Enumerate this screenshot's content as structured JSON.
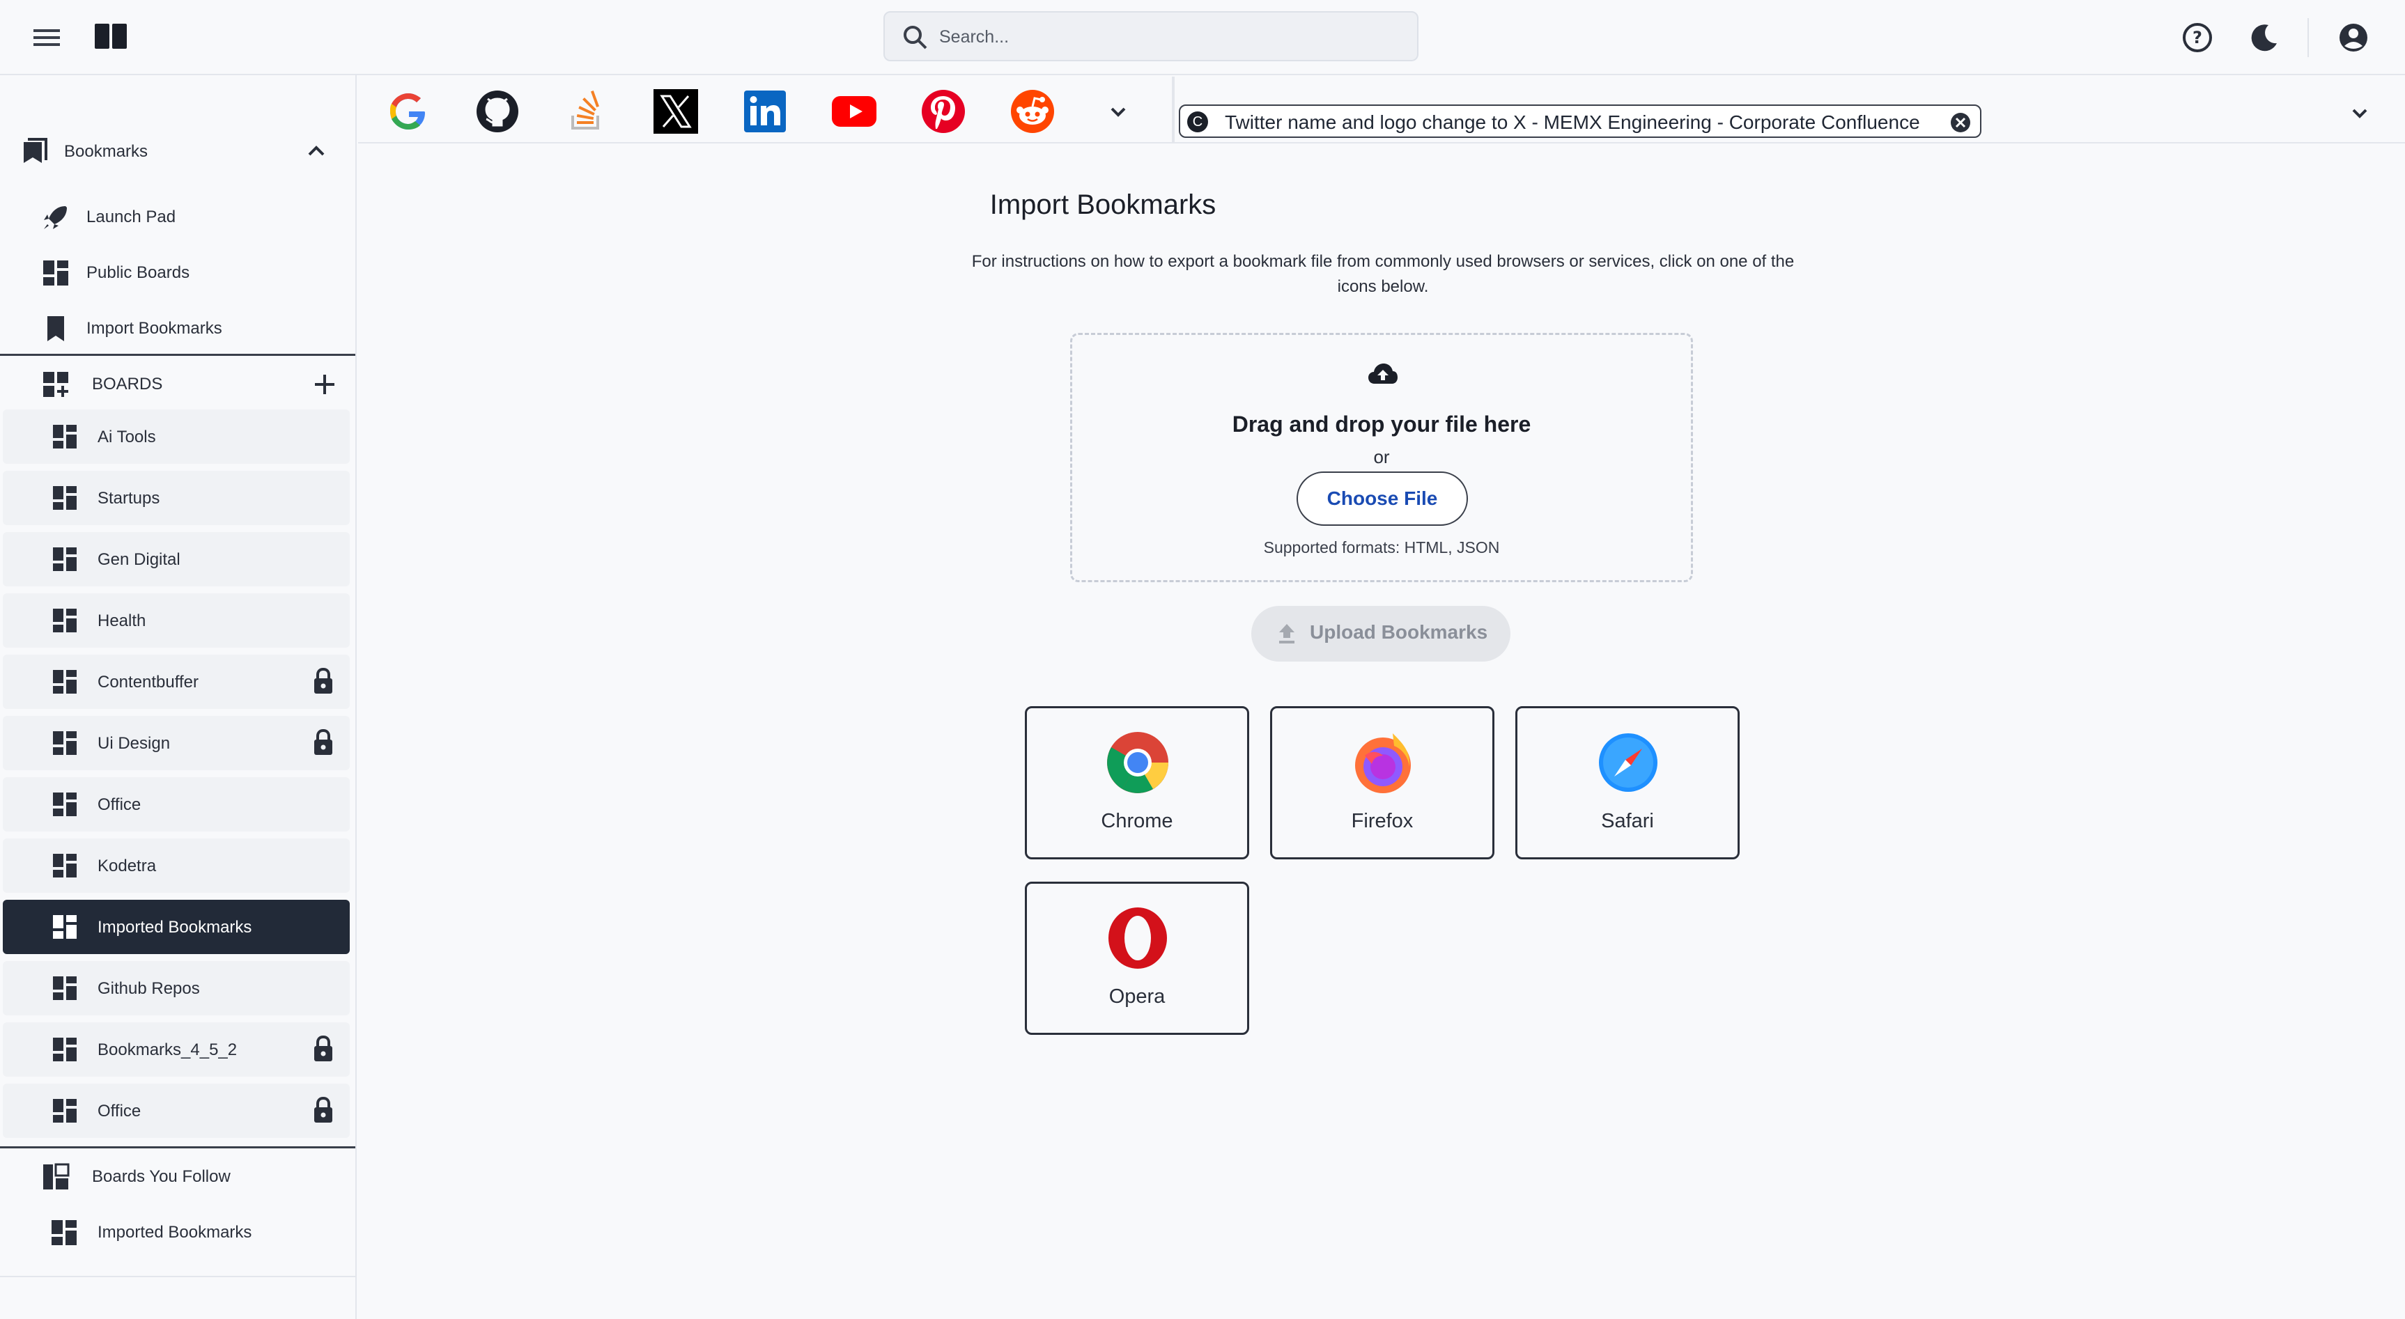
{
  "search": {
    "placeholder": "Search..."
  },
  "sidebar": {
    "section_title": "Bookmarks",
    "links": [
      {
        "label": "Launch Pad",
        "icon": "rocket-icon"
      },
      {
        "label": "Public Boards",
        "icon": "dashboard-icon"
      },
      {
        "label": "Import Bookmarks",
        "icon": "bookmark-icon"
      }
    ],
    "boards_header": "BOARDS",
    "boards": [
      {
        "label": "Ai Tools",
        "locked": false
      },
      {
        "label": "Startups",
        "locked": false
      },
      {
        "label": "Gen Digital",
        "locked": false
      },
      {
        "label": "Health",
        "locked": false
      },
      {
        "label": "Contentbuffer",
        "locked": true
      },
      {
        "label": "Ui Design",
        "locked": true
      },
      {
        "label": "Office",
        "locked": false
      },
      {
        "label": "Kodetra",
        "locked": false
      },
      {
        "label": "Imported Bookmarks",
        "locked": false,
        "active": true
      },
      {
        "label": "Github Repos",
        "locked": false
      },
      {
        "label": "Bookmarks_4_5_2",
        "locked": true
      },
      {
        "label": "Office",
        "locked": true
      }
    ],
    "follow_label": "Boards You Follow",
    "followed": [
      {
        "label": "Imported Bookmarks"
      }
    ]
  },
  "shortcuts": [
    "google-icon",
    "github-icon",
    "stackoverflow-icon",
    "x-icon",
    "linkedin-icon",
    "youtube-icon",
    "pinterest-icon",
    "reddit-icon"
  ],
  "tab": {
    "favicon_letter": "C",
    "title": "Twitter name and logo change to X - MEMX Engineering - Corporate Confluence"
  },
  "main": {
    "title": "Import Bookmarks",
    "instructions": "For instructions on how to export a bookmark file from commonly used browsers or services, click on one of the icons below.",
    "drop_title": "Drag and drop your file here",
    "or": "or",
    "choose_file": "Choose File",
    "formats": "Supported formats: HTML, JSON",
    "upload": "Upload Bookmarks",
    "browsers": [
      "Chrome",
      "Firefox",
      "Safari",
      "Opera"
    ]
  },
  "colors": {
    "active_board": "#222a38",
    "link_blue": "#1a4bb3"
  }
}
